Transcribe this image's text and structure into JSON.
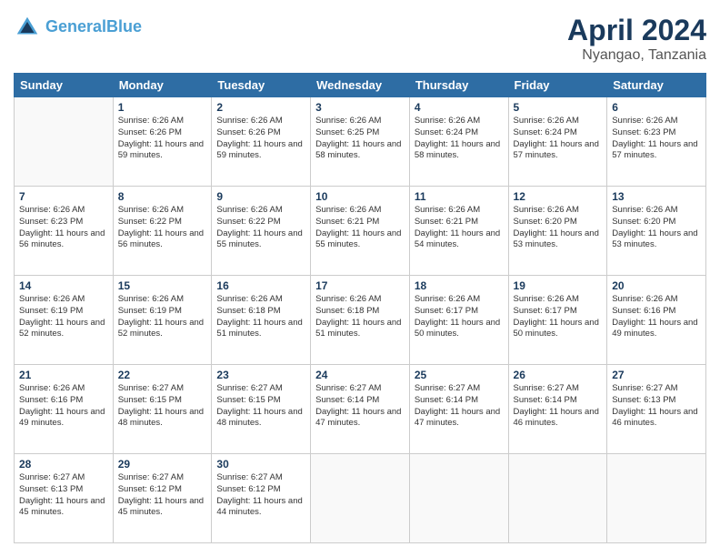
{
  "header": {
    "logo_line1": "General",
    "logo_line2": "Blue",
    "month": "April 2024",
    "location": "Nyangao, Tanzania"
  },
  "days_of_week": [
    "Sunday",
    "Monday",
    "Tuesday",
    "Wednesday",
    "Thursday",
    "Friday",
    "Saturday"
  ],
  "weeks": [
    [
      null,
      {
        "num": "1",
        "sunrise": "6:26 AM",
        "sunset": "6:26 PM",
        "daylight": "11 hours and 59 minutes."
      },
      {
        "num": "2",
        "sunrise": "6:26 AM",
        "sunset": "6:26 PM",
        "daylight": "11 hours and 59 minutes."
      },
      {
        "num": "3",
        "sunrise": "6:26 AM",
        "sunset": "6:25 PM",
        "daylight": "11 hours and 58 minutes."
      },
      {
        "num": "4",
        "sunrise": "6:26 AM",
        "sunset": "6:24 PM",
        "daylight": "11 hours and 58 minutes."
      },
      {
        "num": "5",
        "sunrise": "6:26 AM",
        "sunset": "6:24 PM",
        "daylight": "11 hours and 57 minutes."
      },
      {
        "num": "6",
        "sunrise": "6:26 AM",
        "sunset": "6:23 PM",
        "daylight": "11 hours and 57 minutes."
      }
    ],
    [
      {
        "num": "7",
        "sunrise": "6:26 AM",
        "sunset": "6:23 PM",
        "daylight": "11 hours and 56 minutes."
      },
      {
        "num": "8",
        "sunrise": "6:26 AM",
        "sunset": "6:22 PM",
        "daylight": "11 hours and 56 minutes."
      },
      {
        "num": "9",
        "sunrise": "6:26 AM",
        "sunset": "6:22 PM",
        "daylight": "11 hours and 55 minutes."
      },
      {
        "num": "10",
        "sunrise": "6:26 AM",
        "sunset": "6:21 PM",
        "daylight": "11 hours and 55 minutes."
      },
      {
        "num": "11",
        "sunrise": "6:26 AM",
        "sunset": "6:21 PM",
        "daylight": "11 hours and 54 minutes."
      },
      {
        "num": "12",
        "sunrise": "6:26 AM",
        "sunset": "6:20 PM",
        "daylight": "11 hours and 53 minutes."
      },
      {
        "num": "13",
        "sunrise": "6:26 AM",
        "sunset": "6:20 PM",
        "daylight": "11 hours and 53 minutes."
      }
    ],
    [
      {
        "num": "14",
        "sunrise": "6:26 AM",
        "sunset": "6:19 PM",
        "daylight": "11 hours and 52 minutes."
      },
      {
        "num": "15",
        "sunrise": "6:26 AM",
        "sunset": "6:19 PM",
        "daylight": "11 hours and 52 minutes."
      },
      {
        "num": "16",
        "sunrise": "6:26 AM",
        "sunset": "6:18 PM",
        "daylight": "11 hours and 51 minutes."
      },
      {
        "num": "17",
        "sunrise": "6:26 AM",
        "sunset": "6:18 PM",
        "daylight": "11 hours and 51 minutes."
      },
      {
        "num": "18",
        "sunrise": "6:26 AM",
        "sunset": "6:17 PM",
        "daylight": "11 hours and 50 minutes."
      },
      {
        "num": "19",
        "sunrise": "6:26 AM",
        "sunset": "6:17 PM",
        "daylight": "11 hours and 50 minutes."
      },
      {
        "num": "20",
        "sunrise": "6:26 AM",
        "sunset": "6:16 PM",
        "daylight": "11 hours and 49 minutes."
      }
    ],
    [
      {
        "num": "21",
        "sunrise": "6:26 AM",
        "sunset": "6:16 PM",
        "daylight": "11 hours and 49 minutes."
      },
      {
        "num": "22",
        "sunrise": "6:27 AM",
        "sunset": "6:15 PM",
        "daylight": "11 hours and 48 minutes."
      },
      {
        "num": "23",
        "sunrise": "6:27 AM",
        "sunset": "6:15 PM",
        "daylight": "11 hours and 48 minutes."
      },
      {
        "num": "24",
        "sunrise": "6:27 AM",
        "sunset": "6:14 PM",
        "daylight": "11 hours and 47 minutes."
      },
      {
        "num": "25",
        "sunrise": "6:27 AM",
        "sunset": "6:14 PM",
        "daylight": "11 hours and 47 minutes."
      },
      {
        "num": "26",
        "sunrise": "6:27 AM",
        "sunset": "6:14 PM",
        "daylight": "11 hours and 46 minutes."
      },
      {
        "num": "27",
        "sunrise": "6:27 AM",
        "sunset": "6:13 PM",
        "daylight": "11 hours and 46 minutes."
      }
    ],
    [
      {
        "num": "28",
        "sunrise": "6:27 AM",
        "sunset": "6:13 PM",
        "daylight": "11 hours and 45 minutes."
      },
      {
        "num": "29",
        "sunrise": "6:27 AM",
        "sunset": "6:12 PM",
        "daylight": "11 hours and 45 minutes."
      },
      {
        "num": "30",
        "sunrise": "6:27 AM",
        "sunset": "6:12 PM",
        "daylight": "11 hours and 44 minutes."
      },
      null,
      null,
      null,
      null
    ]
  ]
}
